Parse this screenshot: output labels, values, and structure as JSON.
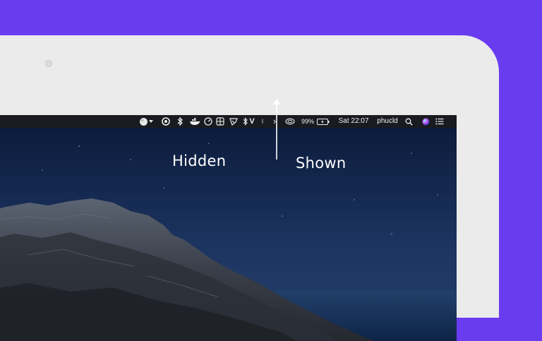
{
  "colors": {
    "background": "#6a3cf0",
    "bezel": "#ebebeb",
    "menubar": "#1a1b20",
    "menubar_text": "#f1f1f1",
    "annotation_text": "#ffffff"
  },
  "menubar": {
    "icons": [
      "status-indicator-icon",
      "dropdown-triangle-icon",
      "power-circle-icon",
      "bluetooth-like-icon",
      "docker-whale-icon",
      "clock-gauge-icon",
      "grid-window-icon",
      "stopwatch-icon",
      "bluetooth-icon",
      "vpn-v-icon",
      "separator-icon",
      "chevron-right-icon",
      "wifi-icon",
      "battery-charging-icon",
      "search-icon",
      "siri-icon",
      "notification-list-icon"
    ],
    "vpn_letter": "V",
    "separator_glyph": "I",
    "expand_glyph": "›",
    "battery_percent": "99%",
    "clock": "Sat 22:07",
    "user": "phucld"
  },
  "annotations": {
    "hidden_label": "Hidden",
    "shown_label": "Shown"
  }
}
